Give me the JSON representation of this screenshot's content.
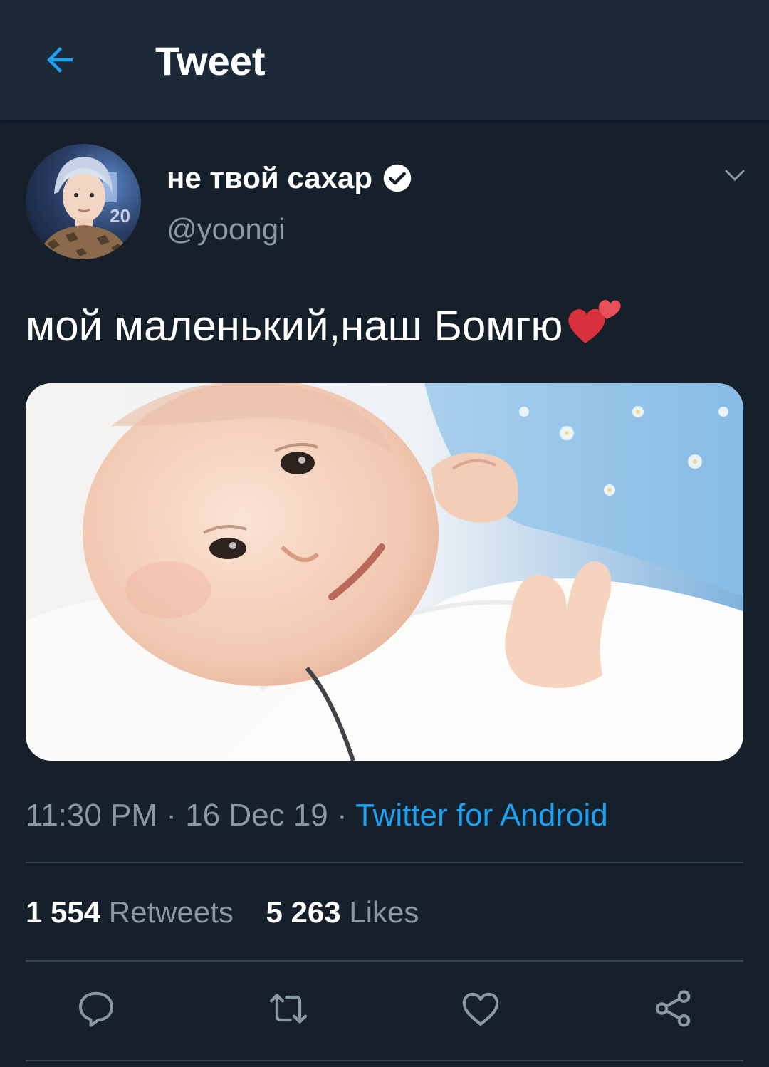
{
  "header": {
    "title": "Tweet",
    "back_icon": "arrow-left-icon"
  },
  "tweet": {
    "author": {
      "display_name": "не твой сахар",
      "handle": "@yoongi",
      "verified": true
    },
    "text": "мой маленький,наш Бомгю",
    "emoji": "two-hearts",
    "meta": {
      "time": "11:30 PM",
      "date": "16 Dec 19",
      "separator": "·",
      "source": "Twitter for Android"
    },
    "stats": {
      "retweets_count": "1 554",
      "retweets_label": "Retweets",
      "likes_count": "5 263",
      "likes_label": "Likes"
    },
    "actions": [
      "reply-icon",
      "retweet-icon",
      "like-icon",
      "share-icon"
    ]
  },
  "colors": {
    "background": "#15202b",
    "topbar": "#1c2938",
    "accent": "#1da1f2",
    "secondary_text": "#8899a6",
    "divider": "#38444d"
  }
}
